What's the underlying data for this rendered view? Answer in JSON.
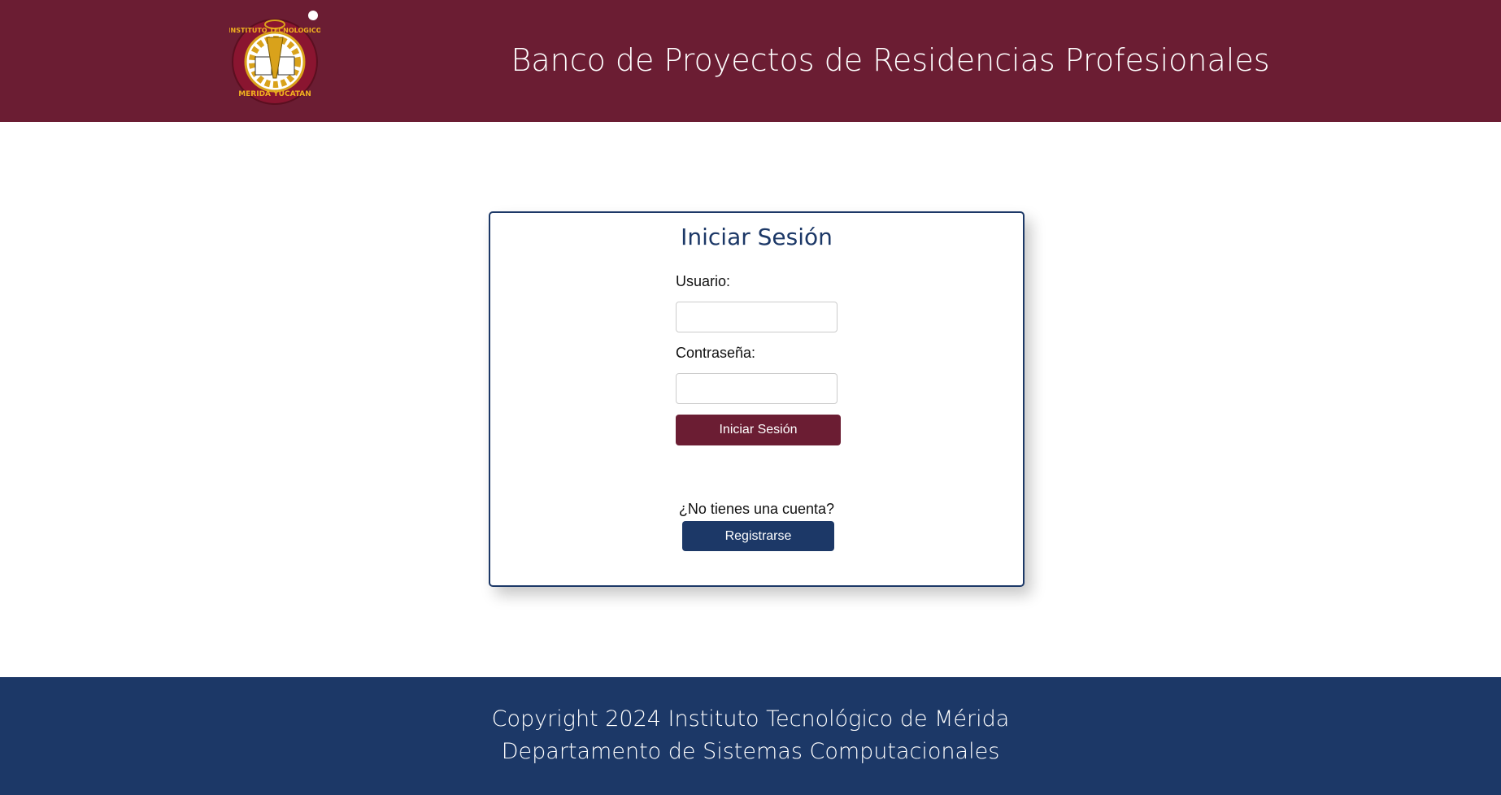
{
  "header": {
    "logo_text": "INSTITUTO TECNOLOGICO MERIDA YUCATAN - IN HOC SIGNO VINCES",
    "title": "Banco de Proyectos de Residencias Profesionales"
  },
  "login": {
    "title": "Iniciar Sesión",
    "username_label": "Usuario:",
    "username_value": "",
    "password_label": "Contraseña:",
    "password_value": "",
    "submit_label": "Iniciar Sesión",
    "no_account_text": "¿No tienes una cuenta?",
    "register_label": "Registrarse"
  },
  "footer": {
    "line1": "Copyright 2024 Instituto Tecnológico de Mérida",
    "line2": "Departamento de Sistemas Computacionales"
  },
  "colors": {
    "primary": "#6b1d33",
    "secondary": "#1c3867"
  }
}
